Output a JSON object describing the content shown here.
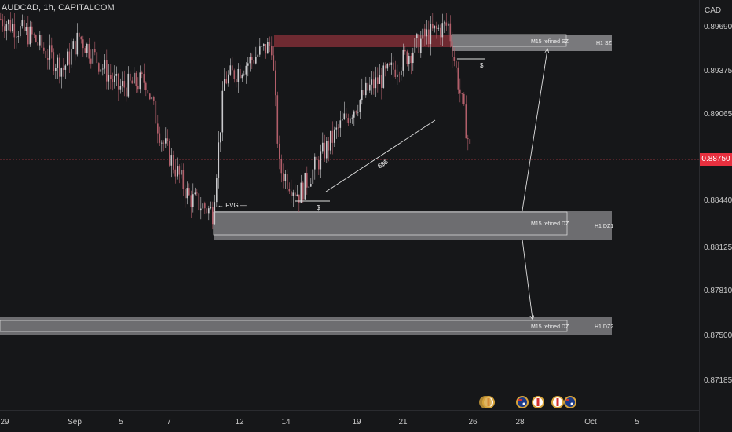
{
  "header": {
    "title": "AUDCAD, 1h, CAPITALCOM"
  },
  "price_axis": {
    "currency": "CAD",
    "ticks": [
      "0.89690",
      "0.89375",
      "0.89065",
      "0.88750",
      "0.88440",
      "0.88125",
      "0.87810",
      "0.87500",
      "0.87185"
    ],
    "last_price": "0.88750",
    "last_price_color": "#e8303f"
  },
  "time_axis": {
    "ticks": [
      "29",
      "Sep",
      "5",
      "7",
      "12",
      "14",
      "19",
      "21",
      "26",
      "28",
      "Oct",
      "5"
    ]
  },
  "zones": {
    "h1_sz": {
      "label": "H1 SZ",
      "refined_label": "M15 refined SZ"
    },
    "h1_dz1": {
      "label": "H1 DZ1",
      "refined_label": "M15 refined DZ"
    },
    "h1_dz2": {
      "label": "H1 DZ2",
      "refined_label": "M15 refined DZ"
    }
  },
  "annotations": {
    "fvg": "← FVG —",
    "liquidity_low": "$",
    "liquidity_high": "$",
    "trendline_liquidity": "$$$"
  },
  "events": {
    "icons": [
      "ca-flag-icon",
      "ca-flag-icon",
      "au-flag-icon",
      "ca-flag-icon",
      "ca-flag-icon",
      "au-flag-icon"
    ]
  },
  "colors": {
    "bull": "#c9c9cc",
    "bear": "#b25f6a",
    "supply_top": "#7e2e36",
    "zone_fill": "#8b8b8e"
  },
  "chart_data": {
    "type": "candlestick",
    "title": "AUDCAD, 1h, CAPITALCOM",
    "ylim": [
      0.8705,
      0.8985
    ],
    "x_range_days": [
      "Aug 29",
      "Oct 5"
    ],
    "approx_close_path": [
      {
        "x": "Aug 29",
        "y": 0.8972
      },
      {
        "x": "Sep 1",
        "y": 0.896
      },
      {
        "x": "Sep 2",
        "y": 0.8948
      },
      {
        "x": "Sep 3",
        "y": 0.8938
      },
      {
        "x": "Sep 4",
        "y": 0.896
      },
      {
        "x": "Sep 5",
        "y": 0.8925
      },
      {
        "x": "Sep 6",
        "y": 0.893
      },
      {
        "x": "Sep 7",
        "y": 0.889
      },
      {
        "x": "Sep 8",
        "y": 0.885
      },
      {
        "x": "Sep 11",
        "y": 0.884
      },
      {
        "x": "Sep 12",
        "y": 0.893
      },
      {
        "x": "Sep 13",
        "y": 0.8955
      },
      {
        "x": "Sep 14",
        "y": 0.887
      },
      {
        "x": "Sep 15",
        "y": 0.8852
      },
      {
        "x": "Sep 18",
        "y": 0.888
      },
      {
        "x": "Sep 19",
        "y": 0.8905
      },
      {
        "x": "Sep 20",
        "y": 0.8925
      },
      {
        "x": "Sep 21",
        "y": 0.894
      },
      {
        "x": "Sep 22",
        "y": 0.896
      },
      {
        "x": "Sep 25",
        "y": 0.8968
      },
      {
        "x": "Sep 26",
        "y": 0.8875
      }
    ],
    "zones": [
      {
        "name": "H1 SZ",
        "from": 0.8958,
        "to": 0.8968
      },
      {
        "name": "H1 DZ1",
        "from": 0.8817,
        "to": 0.8834
      },
      {
        "name": "H1 DZ2",
        "from": 0.8751,
        "to": 0.8758
      }
    ]
  }
}
